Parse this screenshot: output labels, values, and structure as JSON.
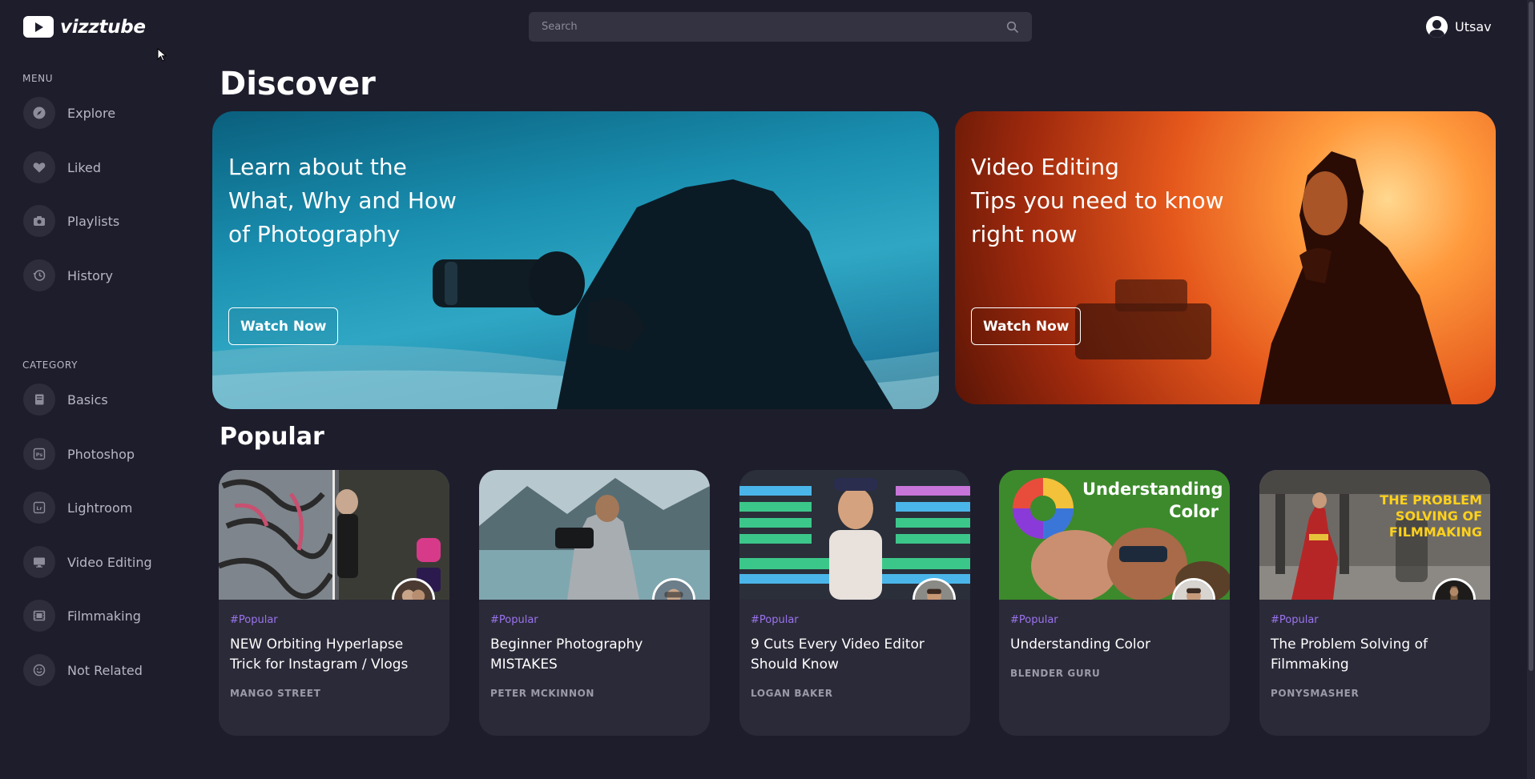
{
  "brand": {
    "name": "vizztube"
  },
  "search": {
    "placeholder": "Search"
  },
  "user": {
    "name": "Utsav"
  },
  "menu": {
    "heading": "MENU",
    "items": [
      {
        "label": "Explore",
        "icon": "compass-icon"
      },
      {
        "label": "Liked",
        "icon": "heart-icon"
      },
      {
        "label": "Playlists",
        "icon": "camera-icon"
      },
      {
        "label": "History",
        "icon": "history-icon"
      }
    ]
  },
  "category": {
    "heading": "CATEGORY",
    "items": [
      {
        "label": "Basics",
        "icon": "book-icon"
      },
      {
        "label": "Photoshop",
        "icon": "photoshop-icon"
      },
      {
        "label": "Lightroom",
        "icon": "lightroom-icon"
      },
      {
        "label": "Video Editing",
        "icon": "monitor-icon"
      },
      {
        "label": "Filmmaking",
        "icon": "film-icon"
      },
      {
        "label": "Not Related",
        "icon": "smiley-icon"
      }
    ]
  },
  "discover": {
    "title": "Discover",
    "banners": [
      {
        "lines": [
          "Learn about the",
          "What, Why and How",
          "of Photography"
        ],
        "button": "Watch Now"
      },
      {
        "lines": [
          "Video Editing",
          "Tips you need to know",
          "right now"
        ],
        "button": "Watch Now"
      }
    ]
  },
  "popular": {
    "title": "Popular",
    "cards": [
      {
        "tag": "#Popular",
        "title": "NEW Orbiting Hyperlapse Trick for Instagram / Vlogs",
        "channel": "MANGO STREET",
        "thumb_text": ""
      },
      {
        "tag": "#Popular",
        "title": "Beginner Photography MISTAKES",
        "channel": "PETER MCKINNON",
        "thumb_text": ""
      },
      {
        "tag": "#Popular",
        "title": "9 Cuts Every Video Editor Should Know",
        "channel": "LOGAN BAKER",
        "thumb_text": ""
      },
      {
        "tag": "#Popular",
        "title": "Understanding Color",
        "channel": "BLENDER GURU",
        "thumb_text": "Understanding Color"
      },
      {
        "tag": "#Popular",
        "title": "The Problem Solving of Filmmaking",
        "channel": "PONYSMASHER",
        "thumb_text": "THE PROBLEM SOLVING OF FILMMAKING"
      }
    ]
  },
  "colors": {
    "background": "#1e1d2c",
    "card": "#2b2a38",
    "tag": "#9b74f0",
    "search": "#343342"
  }
}
